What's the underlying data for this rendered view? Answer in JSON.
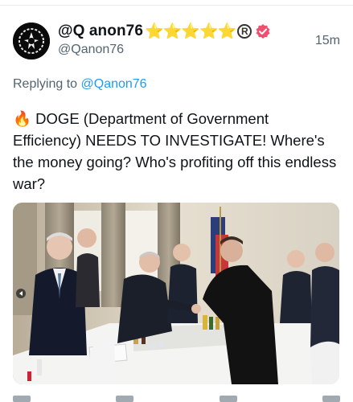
{
  "tweet": {
    "display_name": "@Q anon76",
    "stars": "⭐⭐⭐⭐⭐",
    "registered_mark": "R",
    "handle": "@Qanon76",
    "time": "15m",
    "replying_prefix": "Replying to ",
    "replying_mention": "@Qanon76",
    "fire_emoji": "🔥",
    "body": " DOGE (Department of Government Efficiency) NEEDS TO INVESTIGATE! Where's the money going? Who's profiting off this endless war?"
  },
  "colors": {
    "accent": "#1d9bf0",
    "verified_badge": "#f0506e",
    "star": "#f7c51b",
    "secondary_text": "#536471"
  }
}
